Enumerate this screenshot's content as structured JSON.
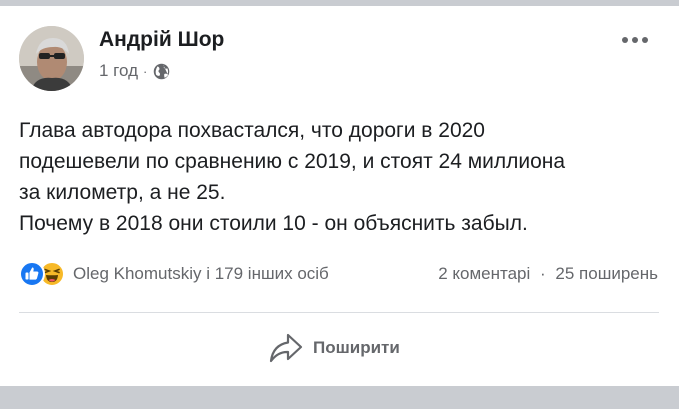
{
  "post": {
    "author": "Андрій Шор",
    "time": "1 год",
    "meta_separator": "·",
    "privacy_icon": "globe-icon",
    "more_icon": "more-dots-icon",
    "text_lines": [
      "Глава автодора похвастался, что дороги в 2020",
      "подешевели по сравнению с 2019, и стоят 24 миллиона",
      "за километр, а не 25.",
      "Почему в 2018 они стоили 10 - он объяснить забыл."
    ]
  },
  "reactions": {
    "icons": [
      "like-icon",
      "haha-icon"
    ],
    "summary": "Oleg  Khomutskiy і 179 інших осіб",
    "comments": "2 коментарі",
    "separator": "·",
    "shares": "25 поширень"
  },
  "actions": {
    "share_label": "Поширити",
    "share_icon": "share-arrow-icon"
  },
  "colors": {
    "text": "#1c1e21",
    "secondary": "#65676b",
    "like_blue": "#1877f2",
    "haha_yellow": "#f7b928",
    "band_gray": "#c9ccd1"
  }
}
